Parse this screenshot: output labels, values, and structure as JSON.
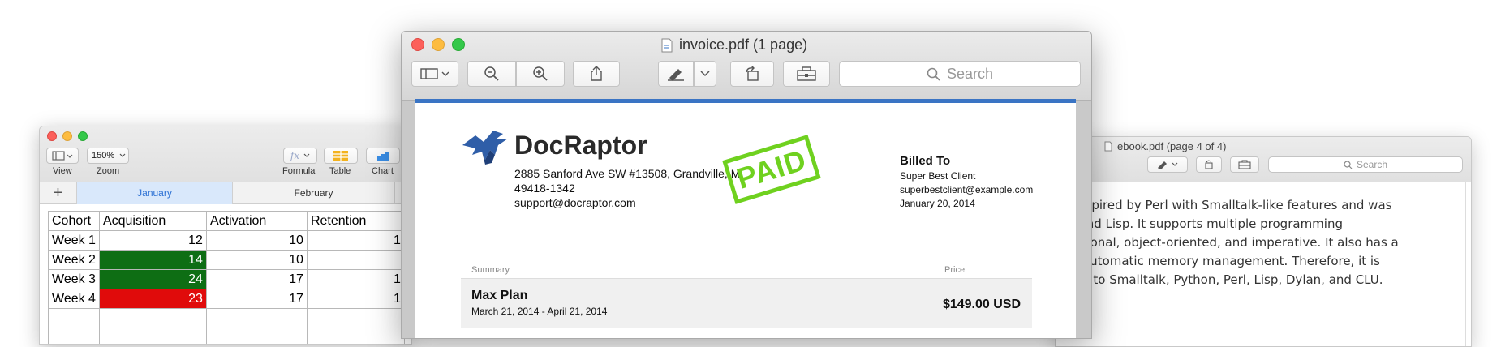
{
  "numbers": {
    "toolbar": {
      "view_label": "View",
      "zoom_value": "150%",
      "zoom_label": "Zoom",
      "formula_label": "Formula",
      "formula_glyph": "fx",
      "table_label": "Table",
      "chart_label": "Chart"
    },
    "tabs": [
      "January",
      "February"
    ],
    "add_sheet": "+",
    "headers": [
      "Cohort",
      "Acquisition",
      "Activation",
      "Retention"
    ],
    "rows": [
      {
        "cohort": "Week 1",
        "acq": "12",
        "act": "10",
        "ret": "1"
      },
      {
        "cohort": "Week 2",
        "acq": "14",
        "act": "10",
        "ret": ""
      },
      {
        "cohort": "Week 3",
        "acq": "24",
        "act": "17",
        "ret": "1"
      },
      {
        "cohort": "Week 4",
        "acq": "23",
        "act": "17",
        "ret": "1"
      }
    ],
    "colors": {
      "green": "#0e6e14",
      "red": "#e00b0b"
    }
  },
  "invoice_window": {
    "title": "invoice.pdf (1 page)",
    "search_placeholder": "Search",
    "accent": "#3a74c4"
  },
  "invoice": {
    "company": "DocRaptor",
    "address_line1": "2885 Sanford Ave SW #13508, Grandville, MI",
    "address_line2": "49418-1342",
    "email": "support@docraptor.com",
    "stamp": "PAID",
    "billed_to_label": "Billed To",
    "client_name": "Super Best Client",
    "client_email": "superbestclient@example.com",
    "date": "January 20, 2014",
    "summary_label": "Summary",
    "price_label": "Price",
    "plan_name": "Max Plan",
    "plan_dates": "March 21, 2014 - April 21, 2014",
    "plan_price": "$149.00 USD",
    "stamp_color": "#6fd11f"
  },
  "ebook_window": {
    "title": "ebook.pdf (page 4 of 4)",
    "search_placeholder": "Search",
    "lines": [
      "ax inspired by Perl with Smalltalk-like features and was",
      "ffel and Lisp. It supports multiple programming",
      "functional, object-oriented, and imperative. It also has a",
      "and automatic memory management. Therefore, it is",
      "grees to Smalltalk, Python, Perl, Lisp, Dylan, and CLU."
    ]
  }
}
